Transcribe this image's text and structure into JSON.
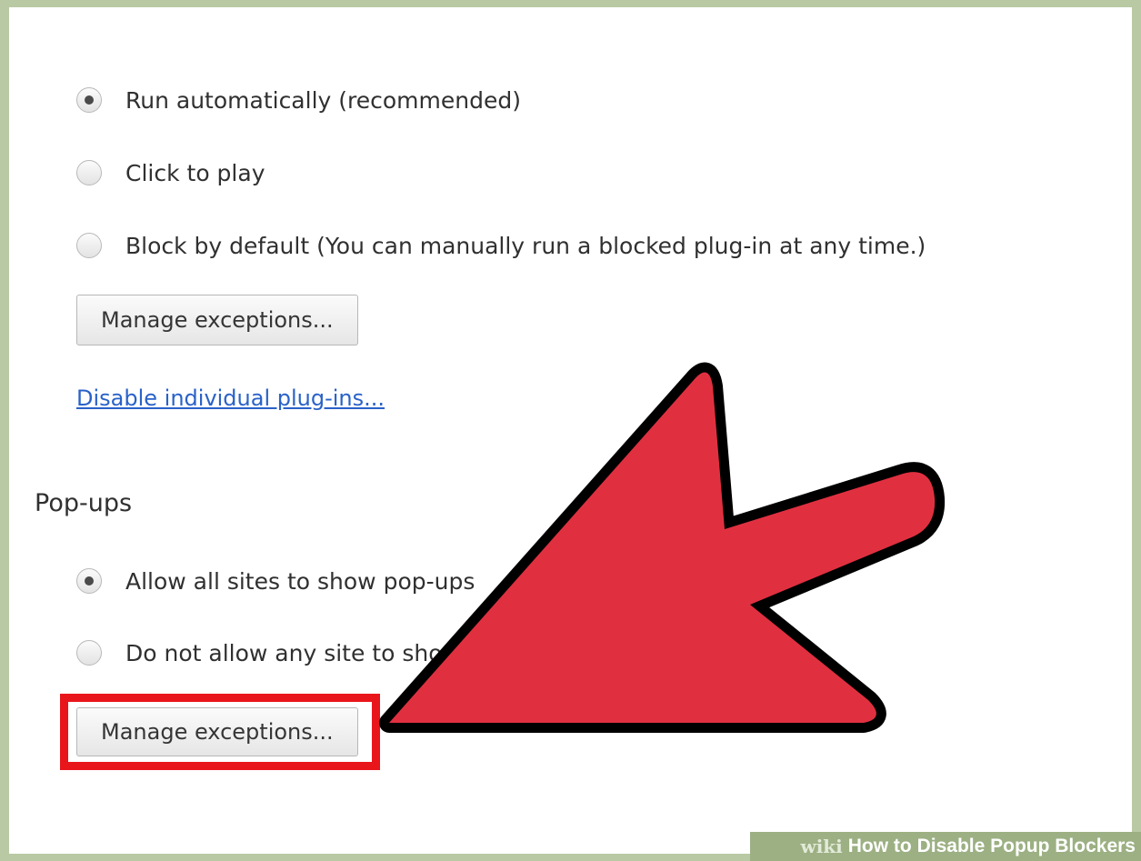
{
  "plugins": {
    "options": [
      {
        "label": "Run automatically (recommended)",
        "checked": true
      },
      {
        "label": "Click to play",
        "checked": false
      },
      {
        "label": "Block by default (You can manually run a blocked plug-in at any time.)",
        "checked": false
      }
    ],
    "manage_button": "Manage exceptions...",
    "disable_link": "Disable individual plug-ins..."
  },
  "popups": {
    "title": "Pop-ups",
    "options": [
      {
        "label": "Allow all sites to show pop-ups",
        "checked": true
      },
      {
        "label": "Do not allow any site to show pop-ups (recommended)",
        "checked": false
      }
    ],
    "manage_button": "Manage exceptions..."
  },
  "annotations": {
    "highlight_color": "#e8161b",
    "arrow_color": "#e03040"
  },
  "watermark": {
    "brand": "wiki",
    "title": "How to Disable Popup Blockers"
  }
}
